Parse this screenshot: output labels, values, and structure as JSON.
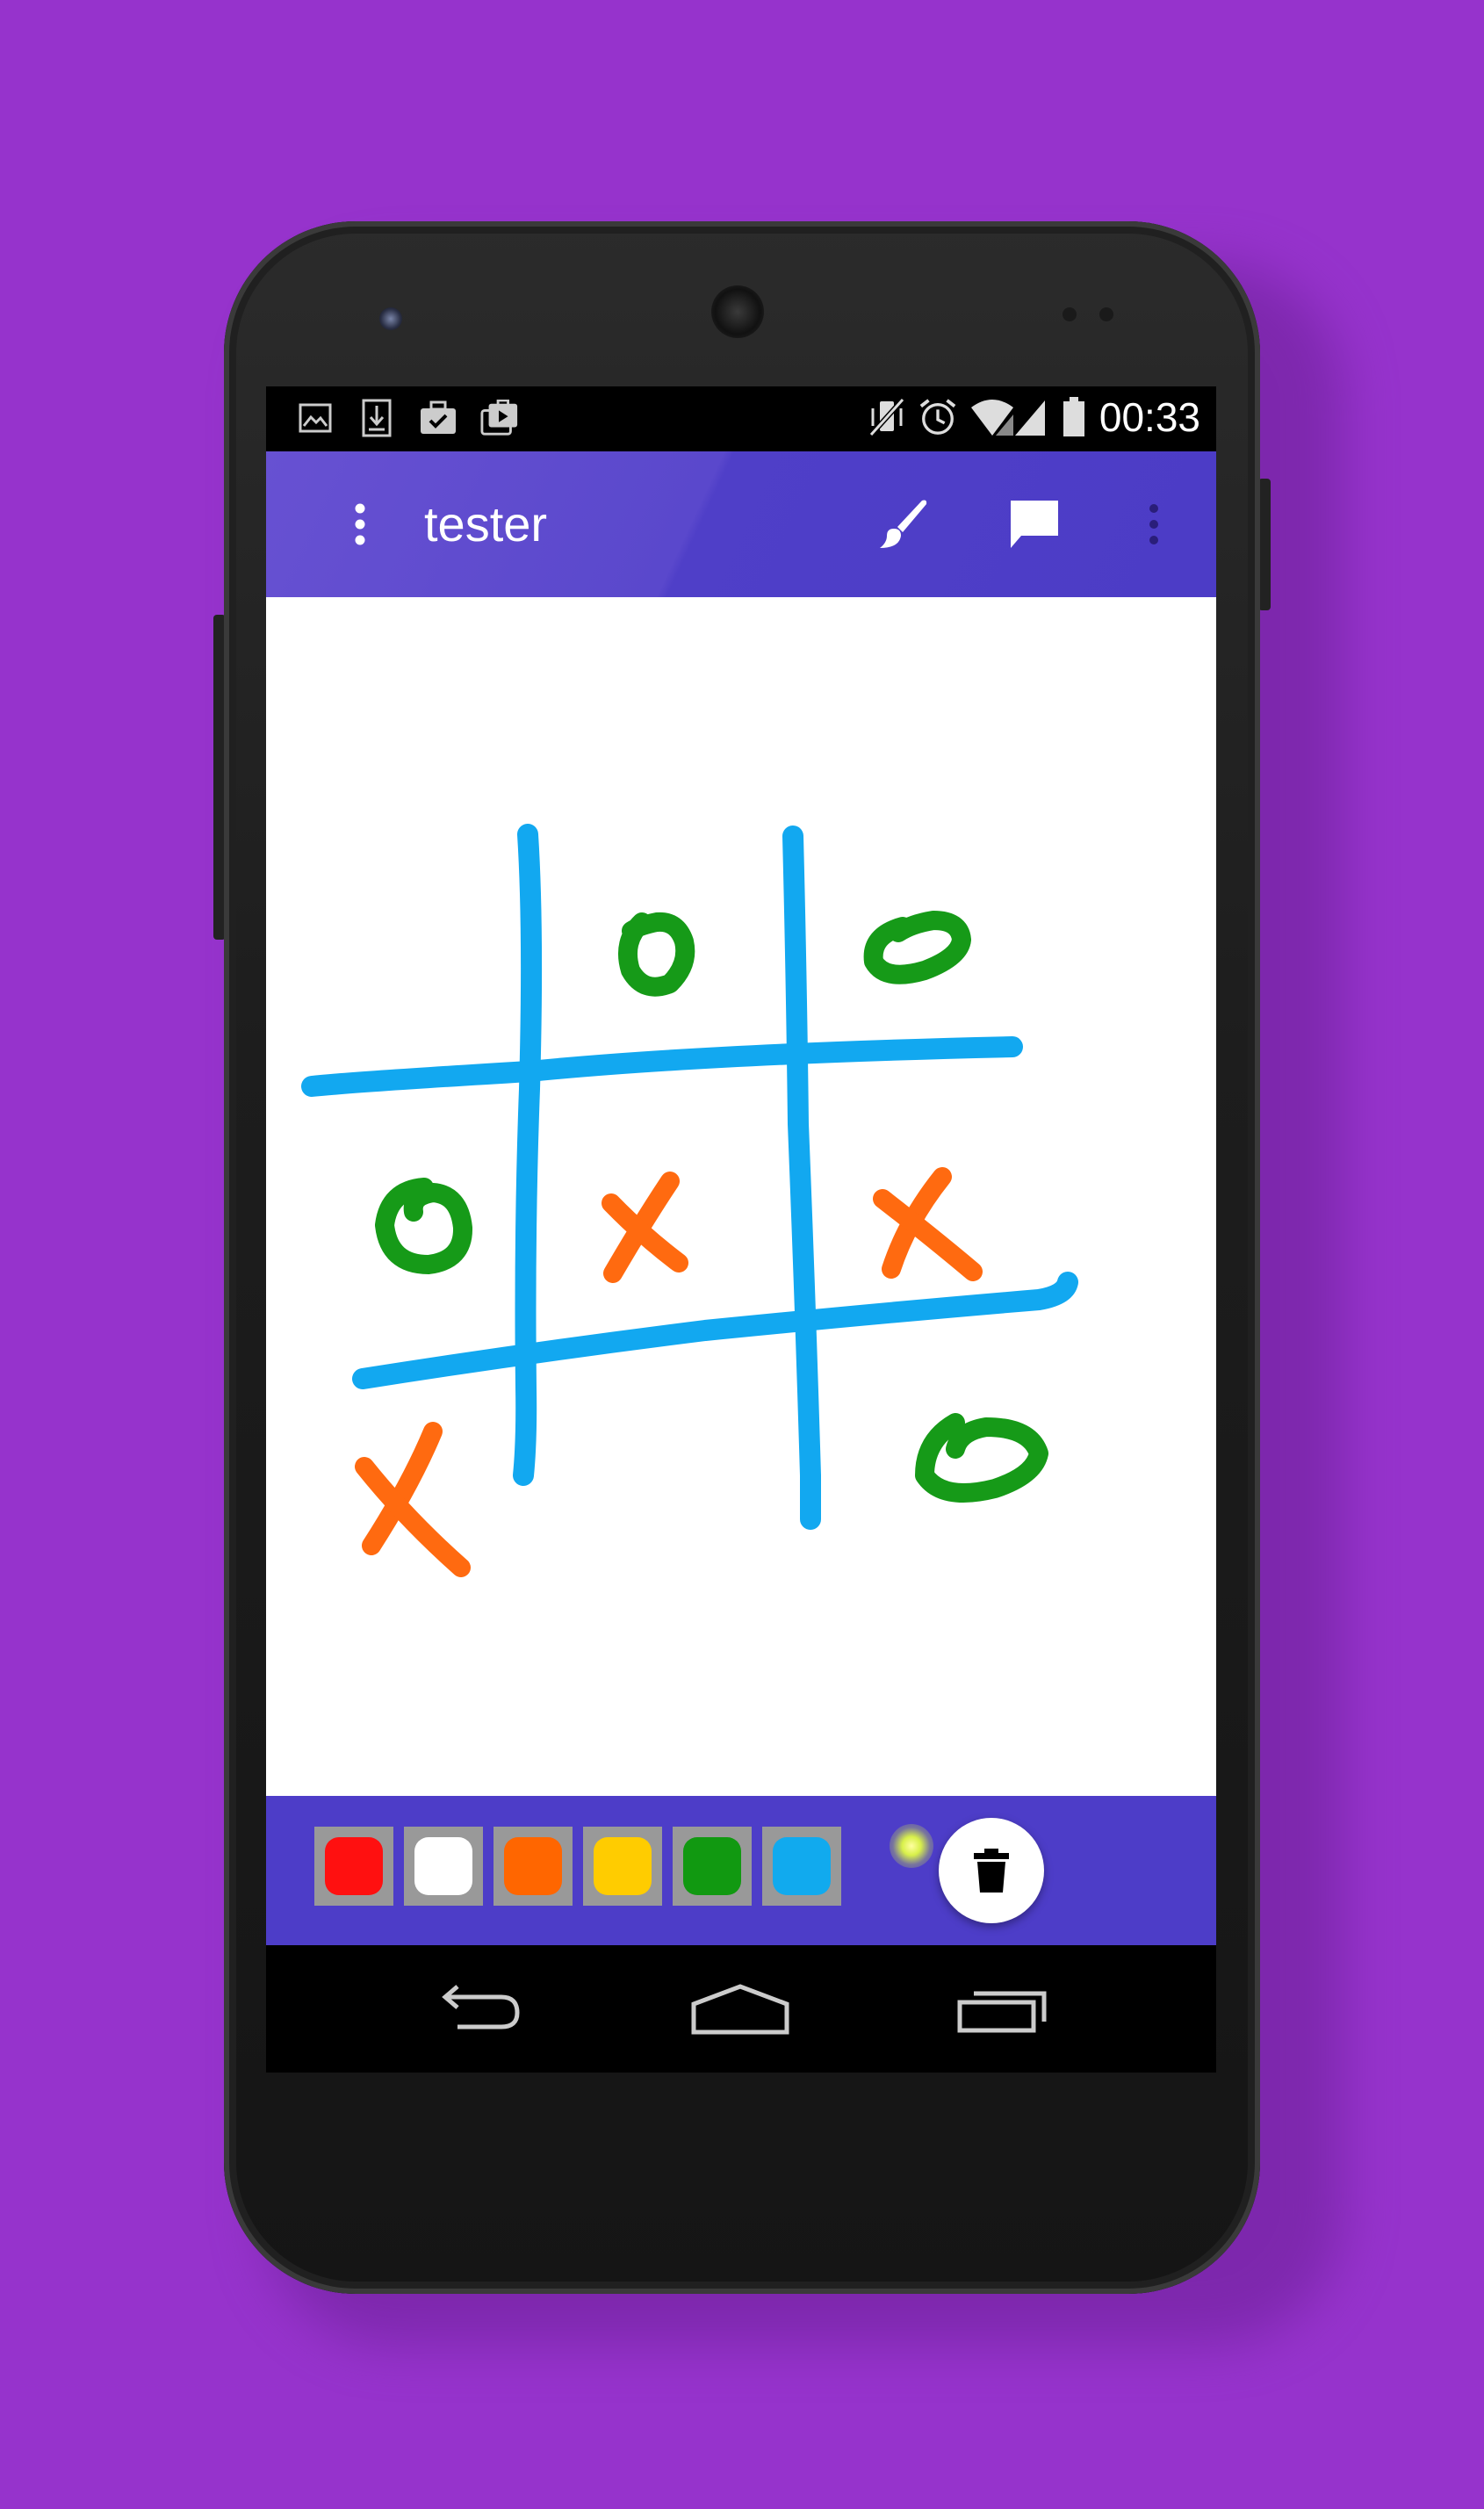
{
  "status_bar": {
    "time": "00:33",
    "left_icons": [
      "image-icon",
      "download-icon",
      "briefcase-check-icon",
      "briefcase-play-icon"
    ],
    "right_icons": [
      "vibrate-off-icon",
      "alarm-icon",
      "wifi-icon",
      "signal-icon",
      "battery-icon"
    ]
  },
  "app_bar": {
    "title": "tester",
    "actions": [
      "brush-icon",
      "comment-icon",
      "overflow-menu-icon"
    ]
  },
  "palette": {
    "colors": [
      "#ff1010",
      "#ffffff",
      "#ff6600",
      "#ffcc00",
      "#119911",
      "#11aaee"
    ],
    "clear_icon": "delete-icon"
  },
  "drawing": {
    "grid_color": "#12a8f0",
    "x_color": "#ff6a10",
    "o_color": "#169a18"
  },
  "nav_bar": {
    "buttons": [
      "back-icon",
      "home-icon",
      "recents-icon"
    ]
  }
}
